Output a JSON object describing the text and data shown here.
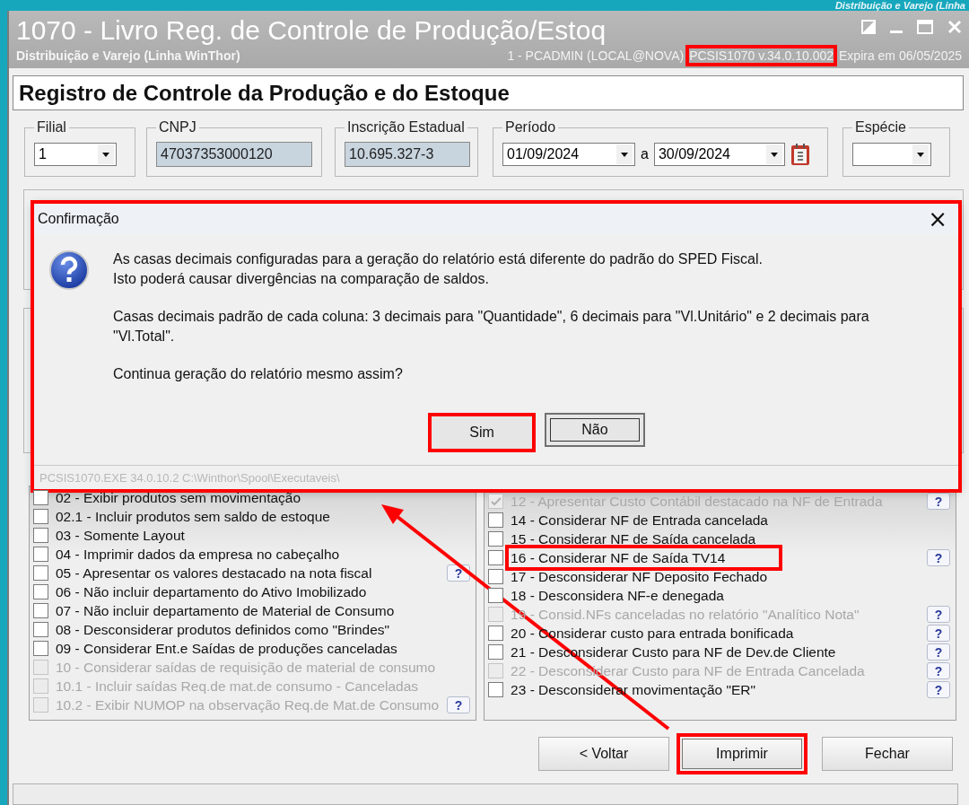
{
  "background_caption": "Distribuição e Varejo (Linha",
  "window": {
    "title": "1070 - Livro Reg. de Controle de Produção/Estoq",
    "subtitle": "Distribuição e Varejo (Linha WinThor)",
    "user": "1 - PCADMIN (LOCAL@NOVA)",
    "version": {
      "text": "PCSIS1070  v.34.0.10.002",
      "highlighted": true
    },
    "expiry": "Expira em 06/05/2025"
  },
  "header": "Registro de Controle da Produção e do Estoque",
  "filters": {
    "filial": {
      "label": "Filial",
      "value": "1"
    },
    "cnpj": {
      "label": "CNPJ",
      "value": "47037353000120"
    },
    "inscricao": {
      "label": "Inscrição Estadual",
      "value": "10.695.327-3"
    },
    "periodo": {
      "label": "Período",
      "from": "01/09/2024",
      "separator": "a",
      "to": "30/09/2024"
    },
    "especie": {
      "label": "Espécie"
    }
  },
  "options_left": [
    {
      "label": "02 - Exibir produtos sem movimentação",
      "checked": false,
      "disabled": false,
      "highlighted": false
    },
    {
      "label": "02.1 - Incluir produtos sem saldo de estoque",
      "checked": false,
      "disabled": false,
      "highlighted": false
    },
    {
      "label": "03 - Somente Layout",
      "checked": false,
      "disabled": false,
      "highlighted": false
    },
    {
      "label": "04 - Imprimir dados da empresa no cabeçalho",
      "checked": false,
      "disabled": false,
      "highlighted": false
    },
    {
      "label": "05 - Apresentar os valores destacado na nota fiscal",
      "checked": false,
      "disabled": false,
      "highlighted": false,
      "help": "?"
    },
    {
      "label": "06 - Não incluir departamento do Ativo Imobilizado",
      "checked": false,
      "disabled": false,
      "highlighted": false
    },
    {
      "label": "07 - Não incluir departamento de Material de Consumo",
      "checked": false,
      "disabled": false,
      "highlighted": false
    },
    {
      "label": "08 - Desconsiderar produtos definidos como \"Brindes\"",
      "checked": false,
      "disabled": false,
      "highlighted": false
    },
    {
      "label": "09 - Considerar Ent.e Saídas de produções canceladas",
      "checked": false,
      "disabled": false,
      "highlighted": false
    },
    {
      "label": "10 - Considerar saídas de requisição de material de consumo",
      "checked": false,
      "disabled": true,
      "highlighted": false
    },
    {
      "label": "10.1 - Incluir saídas Req.de mat.de consumo - Canceladas",
      "checked": false,
      "disabled": true,
      "highlighted": false
    },
    {
      "label": "10.2 - Exibir NUMOP na observação Req.de Mat.de Consumo",
      "checked": false,
      "disabled": true,
      "highlighted": false,
      "help": "?"
    }
  ],
  "options_right": [
    {
      "label": "12 - Apresentar Custo Contábil destacado na NF de Entrada",
      "checked": true,
      "disabled": true,
      "highlighted": false,
      "help": "?"
    },
    {
      "label": "14 - Considerar NF de Entrada cancelada",
      "checked": false,
      "disabled": false,
      "highlighted": false
    },
    {
      "label": "15 - Considerar NF de Saída cancelada",
      "checked": false,
      "disabled": false,
      "highlighted": false
    },
    {
      "label": "16 - Considerar NF de Saída TV14",
      "checked": false,
      "disabled": false,
      "highlighted": true,
      "help": "?"
    },
    {
      "label": "17 - Desconsiderar NF Deposito Fechado",
      "checked": false,
      "disabled": false,
      "highlighted": false
    },
    {
      "label": "18 - Desconsidera NF-e denegada",
      "checked": false,
      "disabled": false,
      "highlighted": false
    },
    {
      "label": "19 - Consid.NFs canceladas no relatório \"Analítico Nota\"",
      "checked": false,
      "disabled": true,
      "highlighted": false,
      "help": "?"
    },
    {
      "label": "20 - Considerar custo para entrada bonificada",
      "checked": false,
      "disabled": false,
      "highlighted": false,
      "help": "?"
    },
    {
      "label": "21 - Desconsiderar Custo para NF de Dev.de Cliente",
      "checked": false,
      "disabled": false,
      "highlighted": false,
      "help": "?"
    },
    {
      "label": "22 - Desconsiderar Custo para NF de Entrada Cancelada",
      "checked": false,
      "disabled": true,
      "highlighted": false,
      "help": "?"
    },
    {
      "label": "23 - Desconsiderar movimentação \"ER\"",
      "checked": false,
      "disabled": false,
      "highlighted": false,
      "help": "?"
    }
  ],
  "buttons": [
    {
      "label": "< Voltar",
      "highlighted": false
    },
    {
      "label": "Imprimir",
      "highlighted": true
    },
    {
      "label": "Fechar",
      "highlighted": false
    }
  ],
  "dialog": {
    "title": "Confirmação",
    "close": "×",
    "highlighted": true,
    "lines": [
      "As casas decimais configuradas para a geração do relatório está diferente do padrão do SPED Fiscal.",
      "Isto poderá causar divergências na comparação de saldos."
    ],
    "detail": "Casas decimais padrão de cada coluna: 3 decimais para \"Quantidade\", 6 decimais para \"Vl.Unitário\" e 2 decimais para \"Vl.Total\".",
    "question": "Continua geração do relatório mesmo assim?",
    "buttons": [
      {
        "label": "Sim",
        "focused": false,
        "highlighted": true
      },
      {
        "label": "Não",
        "focused": true,
        "highlighted": false
      }
    ],
    "footer": "PCSIS1070.EXE 34.0.10.2 C:\\Winthor\\Spool\\Executaveis\\"
  }
}
